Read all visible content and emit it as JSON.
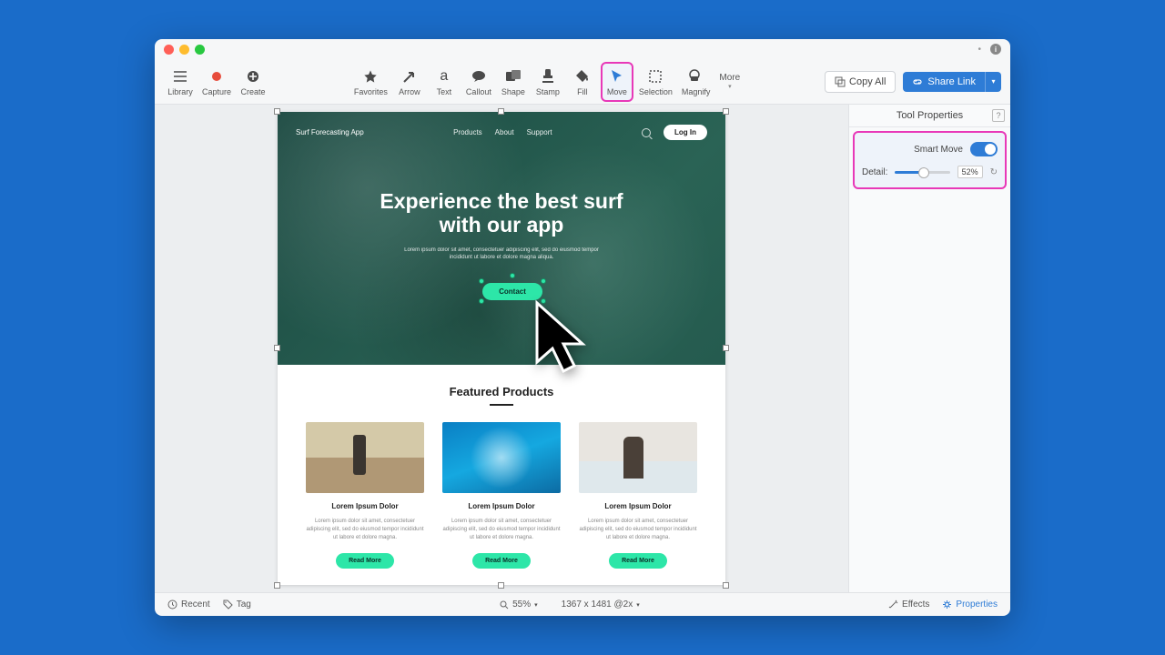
{
  "toolbar_left": {
    "library": "Library",
    "capture": "Capture",
    "create": "Create"
  },
  "toolbar_center": {
    "favorites": "Favorites",
    "arrow": "Arrow",
    "text": "Text",
    "callout": "Callout",
    "shape": "Shape",
    "stamp": "Stamp",
    "fill": "Fill",
    "move": "Move",
    "selection": "Selection",
    "magnify": "Magnify",
    "more": "More"
  },
  "toolbar_right": {
    "copy_all": "Copy All",
    "share_link": "Share Link"
  },
  "sidepanel": {
    "title": "Tool Properties",
    "smart_move": "Smart Move",
    "detail": "Detail:",
    "detail_value": "52%"
  },
  "canvas": {
    "hero": {
      "brand": "Surf Forecasting App",
      "nav": [
        "Products",
        "About",
        "Support"
      ],
      "login": "Log In",
      "title_l1": "Experience the best surf",
      "title_l2": "with our app",
      "subtitle": "Lorem ipsum dolor sit amet, consectetuer adipiscing elit, sed do eiusmod tempor incididunt ut labore et dolore magna aliqua.",
      "cta": "Contact"
    },
    "featured": {
      "title": "Featured Products",
      "cards": [
        {
          "title": "Lorem Ipsum Dolor",
          "desc": "Lorem ipsum dolor sit amet, consectetuer adipiscing elit, sed do eiusmod tempor incididunt ut labore et dolore magna.",
          "btn": "Read More"
        },
        {
          "title": "Lorem Ipsum Dolor",
          "desc": "Lorem ipsum dolor sit amet, consectetuer adipiscing elit, sed do eiusmod tempor incididunt ut labore et dolore magna.",
          "btn": "Read More"
        },
        {
          "title": "Lorem Ipsum Dolor",
          "desc": "Lorem ipsum dolor sit amet, consectetuer adipiscing elit, sed do eiusmod tempor incididunt ut labore et dolore magna.",
          "btn": "Read More"
        }
      ]
    }
  },
  "statusbar": {
    "recent": "Recent",
    "tag": "Tag",
    "zoom": "55% ",
    "dims": "1367 x 1481 @2x ",
    "effects": "Effects",
    "properties": "Properties"
  }
}
